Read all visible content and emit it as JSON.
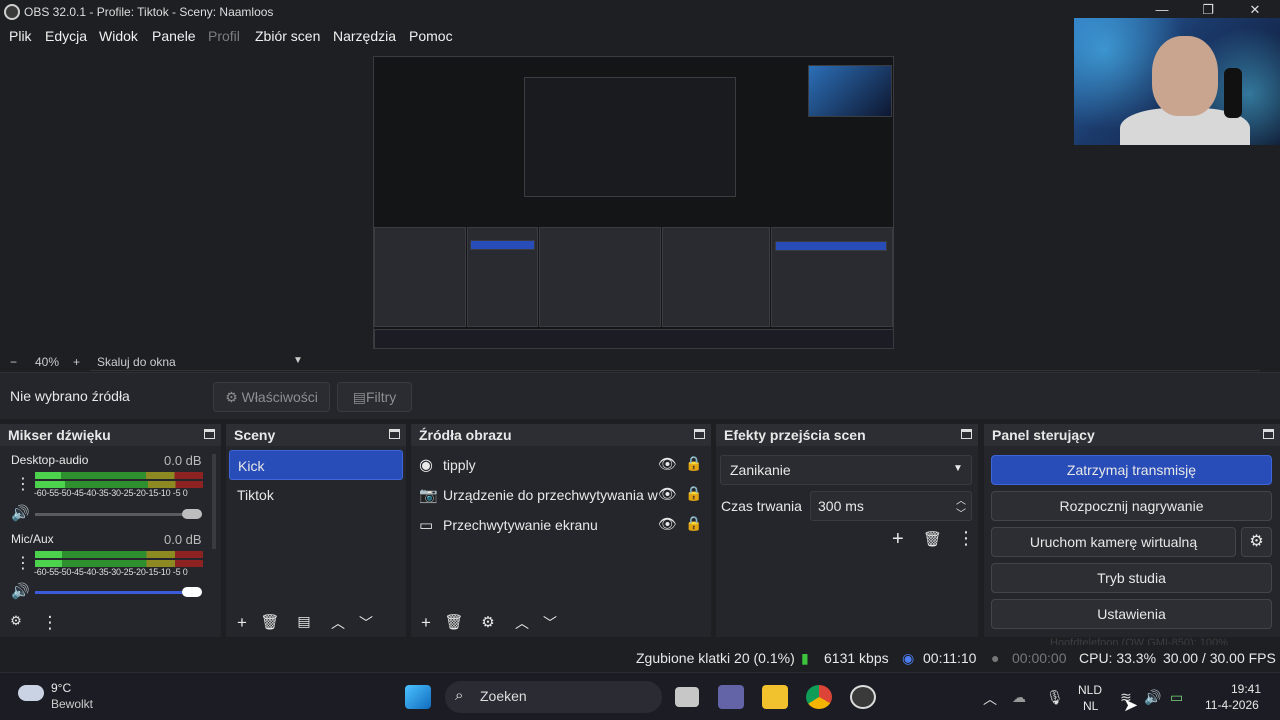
{
  "window": {
    "title": "OBS 32.0.1 - Profile: Tiktok - Sceny: Naamloos",
    "minimize": "—",
    "maximize": "❐",
    "close": "✕"
  },
  "menu": [
    "Plik",
    "Edycja",
    "Widok",
    "Panele",
    "Profil",
    "Zbiór scen",
    "Narzędzia",
    "Pomoc"
  ],
  "zoom": {
    "minus": "−",
    "value": "40%",
    "plus": "+",
    "scale_label": "Skaluj do okna"
  },
  "source_toolbar": {
    "no_source": "Nie wybrano źródła",
    "properties": "Właściwości",
    "filters": "Filtry"
  },
  "mixer": {
    "title": "Mikser dźwięku",
    "channels": [
      {
        "name": "Desktop-audio",
        "db": "0.0 dB",
        "ticks": "-60-55-50-45-40-35-30-25-20-15-10 -5 0",
        "volume": 1.0
      },
      {
        "name": "Mic/Aux",
        "db": "0.0 dB",
        "ticks": "-60-55-50-45-40-35-30-25-20-15-10 -5 0",
        "volume": 1.0
      }
    ]
  },
  "scenes": {
    "title": "Sceny",
    "items": [
      "Kick",
      "Tiktok"
    ],
    "selected": "Kick"
  },
  "sources": {
    "title": "Źródła obrazu",
    "items": [
      "tipply",
      "Urządzenie do przechwytywania w",
      "Przechwytywanie ekranu"
    ]
  },
  "transitions": {
    "title": "Efekty przejścia scen",
    "selected": "Zanikanie",
    "duration_label": "Czas trwania",
    "duration_value": "300 ms"
  },
  "controls": {
    "title": "Panel sterujący",
    "stop_stream": "Zatrzymaj transmisję",
    "start_recording": "Rozpocznij nagrywanie",
    "virtual_camera": "Uruchom kamerę wirtualną",
    "studio_mode": "Tryb studia",
    "settings": "Ustawienia"
  },
  "status": {
    "dropped": "Zgubione klatki 20 (0.1%)",
    "bitrate": "6131 kbps",
    "stream_time": "00:11:10",
    "rec_time": "00:00:00",
    "cpu": "CPU: 33.3%",
    "fps": "30.00 / 30.00 FPS",
    "overlay_hint": "Hoofdtelefoon (QW GMI-850): 100%"
  },
  "taskbar": {
    "weather_temp": "9°C",
    "weather_desc": "Bewolkt",
    "search": "Zoeken",
    "lang1": "NLD",
    "lang2": "NL",
    "time": "19:41",
    "date": "11-4-2026"
  },
  "colors": {
    "accent": "#284cb8",
    "bg": "#1e1f22",
    "panel": "#25262b"
  }
}
